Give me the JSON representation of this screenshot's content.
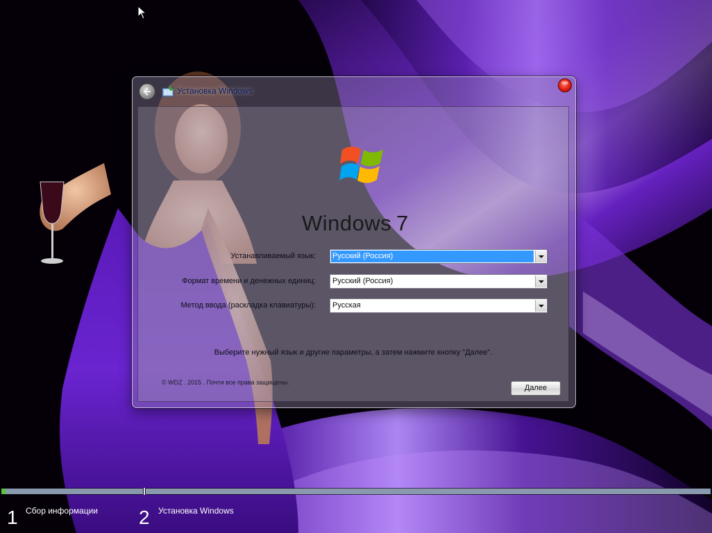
{
  "window": {
    "title": "Установка Windows"
  },
  "branding": {
    "wordmark": "Windows",
    "version": "7"
  },
  "form": {
    "language_label": "Устанавливаемый язык:",
    "language_value": "Русский (Россия)",
    "time_format_label": "Формат времени и денежных единиц:",
    "time_format_value": "Русский (Россия)",
    "keyboard_label": "Метод ввода (раскладка клавиатуры):",
    "keyboard_value": "Русская"
  },
  "instruction": "Выберите нужный язык и другие параметры, а затем нажмите кнопку \"Далее\".",
  "copyright": "© WDZ . 2015 . Почти все права защищены.",
  "buttons": {
    "next_label": "Далее"
  },
  "progress": {
    "steps": [
      {
        "number": "1",
        "label": "Сбор информации"
      },
      {
        "number": "2",
        "label": "Установка Windows"
      }
    ],
    "step1_fill_fraction": 0.03
  },
  "colors": {
    "selection": "#3399ff",
    "progress_fill": "#58c43a",
    "wallpaper_accent": "#6a22c8"
  },
  "icons": {
    "back": "back-arrow-icon",
    "setup": "setup-icon",
    "close": "close-icon",
    "logo": "windows-flag-logo",
    "cursor": "mouse-cursor-icon"
  }
}
